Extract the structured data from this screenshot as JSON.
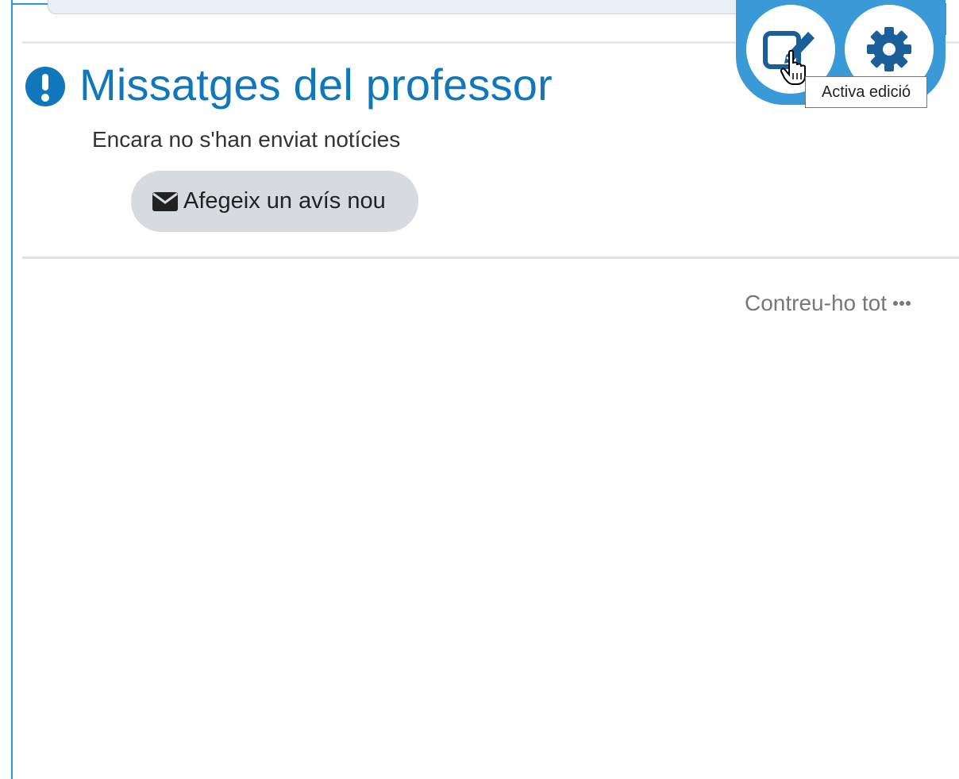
{
  "section": {
    "title": "Missatges del professor",
    "empty_message": "Encara no s'han enviat notícies",
    "add_button_label": "Afegeix un avís nou"
  },
  "toolbar": {
    "edit_tooltip": "Activa edició"
  },
  "course": {
    "collapse_all_label": "Contreu-ho tot"
  },
  "icons": {
    "alert": "exclamation-circle-icon",
    "envelope": "envelope-icon",
    "edit": "edit-pencil-icon",
    "settings": "gear-icon",
    "more": "ellipsis-icon",
    "cursor": "hand-pointer-cursor"
  },
  "colors": {
    "accent": "#1177bb",
    "frame": "#2a9bd8",
    "controls_bg": "#3a9ad8",
    "button_bg": "#d7dbe0",
    "muted_text": "#777777"
  }
}
